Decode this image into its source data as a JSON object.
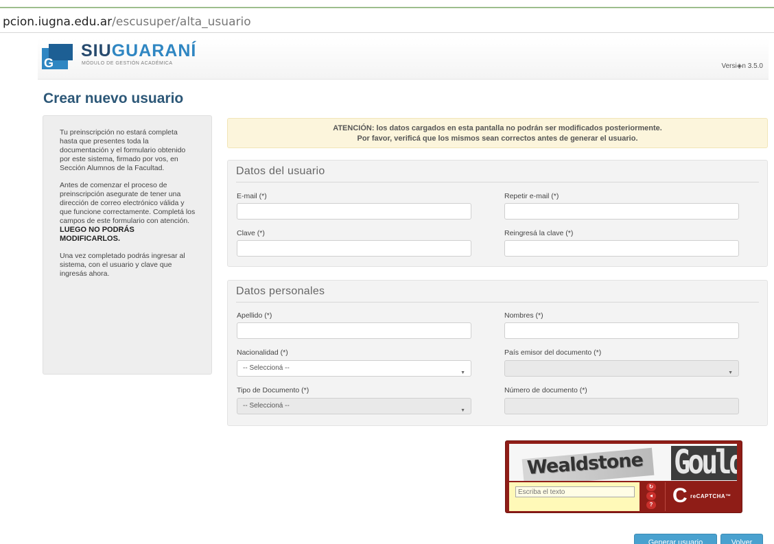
{
  "browser": {
    "url_host": "pcion.iugna.edu.ar",
    "url_path": "/escusuper/alta_usuario"
  },
  "header": {
    "logo_siu": "SIU",
    "logo_guarani": "GUARANÍ",
    "logo_subtitle": "MÓDULO DE GESTIÓN ACADÉMICA",
    "version": "Versi◈n 3.5.0",
    "brand_colors": {
      "dark": "#274a6e",
      "light": "#2f86c2"
    }
  },
  "page": {
    "title": "Crear nuevo usuario"
  },
  "sidebar": {
    "para1": "Tu preinscripción no estará completa hasta que presentes toda la documentación y el formulario obtenido por este sistema, firmado por vos, en Sección Alumnos de la Facultad.",
    "para2": "Antes de comenzar el proceso de preinscripción asegurate de tener una dirección de correo electrónico válida y que funcione correctamente. Completá los campos de este formulario con atención.",
    "para2_strong": "LUEGO NO PODRÁS MODIFICARLOS.",
    "para3": "Una vez completado podrás ingresar al sistema, con el usuario y clave que ingresás ahora."
  },
  "alert": {
    "line1": "ATENCIÓN: los datos cargados en esta pantalla no podrán ser modificados posteriormente.",
    "line2": "Por favor, verificá que los mismos sean correctos antes de generar el usuario."
  },
  "user_panel": {
    "title": "Datos del usuario",
    "email_label": "E-mail (*)",
    "email_repeat_label": "Repetir e-mail (*)",
    "password_label": "Clave (*)",
    "password_repeat_label": "Reingresá la clave (*)"
  },
  "personal_panel": {
    "title": "Datos personales",
    "lastname_label": "Apellido (*)",
    "firstname_label": "Nombres (*)",
    "nationality_label": "Nacionalidad (*)",
    "nationality_value": "-- Seleccioná --",
    "issuer_country_label": "País emisor del documento (*)",
    "doc_type_label": "Tipo de Documento (*)",
    "doc_type_value": "-- Seleccioná --",
    "doc_number_label": "Número de documento (*)"
  },
  "captcha": {
    "word1": "Wealdstone",
    "word2": "Gould",
    "input_placeholder": "Escriba el texto",
    "brand": "reCAPTCHA™"
  },
  "actions": {
    "generate": "Generar usuario",
    "back": "Volver"
  }
}
